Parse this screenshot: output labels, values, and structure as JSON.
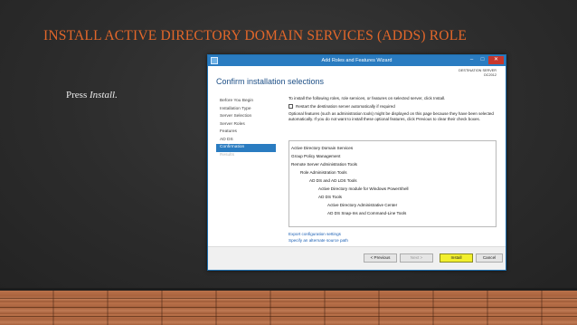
{
  "slide": {
    "title": "INSTALL ACTIVE DIRECTORY DOMAIN SERVICES (ADDS) ROLE",
    "bullet_prefix": "Press ",
    "bullet_emphasis": "Install."
  },
  "wizard": {
    "window_title": "Add Roles and Features Wizard",
    "controls": {
      "minimize": "–",
      "maximize": "□",
      "close": "✕"
    },
    "page_title": "Confirm installation selections",
    "destination_label": "DESTINATION SERVER",
    "destination_server": "DC2012",
    "steps": [
      {
        "label": "Before You Begin",
        "state": "normal"
      },
      {
        "label": "Installation Type",
        "state": "normal"
      },
      {
        "label": "Server Selection",
        "state": "normal"
      },
      {
        "label": "Server Roles",
        "state": "normal"
      },
      {
        "label": "Features",
        "state": "normal"
      },
      {
        "label": "AD DS",
        "state": "normal"
      },
      {
        "label": "Confirmation",
        "state": "active"
      },
      {
        "label": "Results",
        "state": "disabled"
      }
    ],
    "intro_text": "To install the following roles, role services, or features on selected server, click Install.",
    "restart_label": "Restart the destination server automatically if required",
    "optional_text": "Optional features (such as administration tools) might be displayed on this page because they have been selected automatically. If you do not want to install these optional features, click Previous to clear their check boxes.",
    "features": [
      {
        "label": "Active Directory Domain Services",
        "indent": 0
      },
      {
        "label": "Group Policy Management",
        "indent": 0
      },
      {
        "label": "Remote Server Administration Tools",
        "indent": 0
      },
      {
        "label": "Role Administration Tools",
        "indent": 1
      },
      {
        "label": "AD DS and AD LDS Tools",
        "indent": 2
      },
      {
        "label": "Active Directory module for Windows PowerShell",
        "indent": 3
      },
      {
        "label": "AD DS Tools",
        "indent": 3
      },
      {
        "label": "Active Directory Administrative Center",
        "indent": 4
      },
      {
        "label": "AD DS Snap-Ins and Command-Line Tools",
        "indent": 4
      }
    ],
    "links": {
      "export": "Export configuration settings",
      "alternate": "Specify an alternate source path"
    },
    "buttons": {
      "previous": "< Previous",
      "next": "Next >",
      "install": "Install",
      "cancel": "Cancel"
    },
    "colors": {
      "titlebar": "#2a7cc1",
      "heading": "#1d4f86",
      "install_button": "#f2ef2d",
      "slide_title": "#e3672a"
    }
  }
}
